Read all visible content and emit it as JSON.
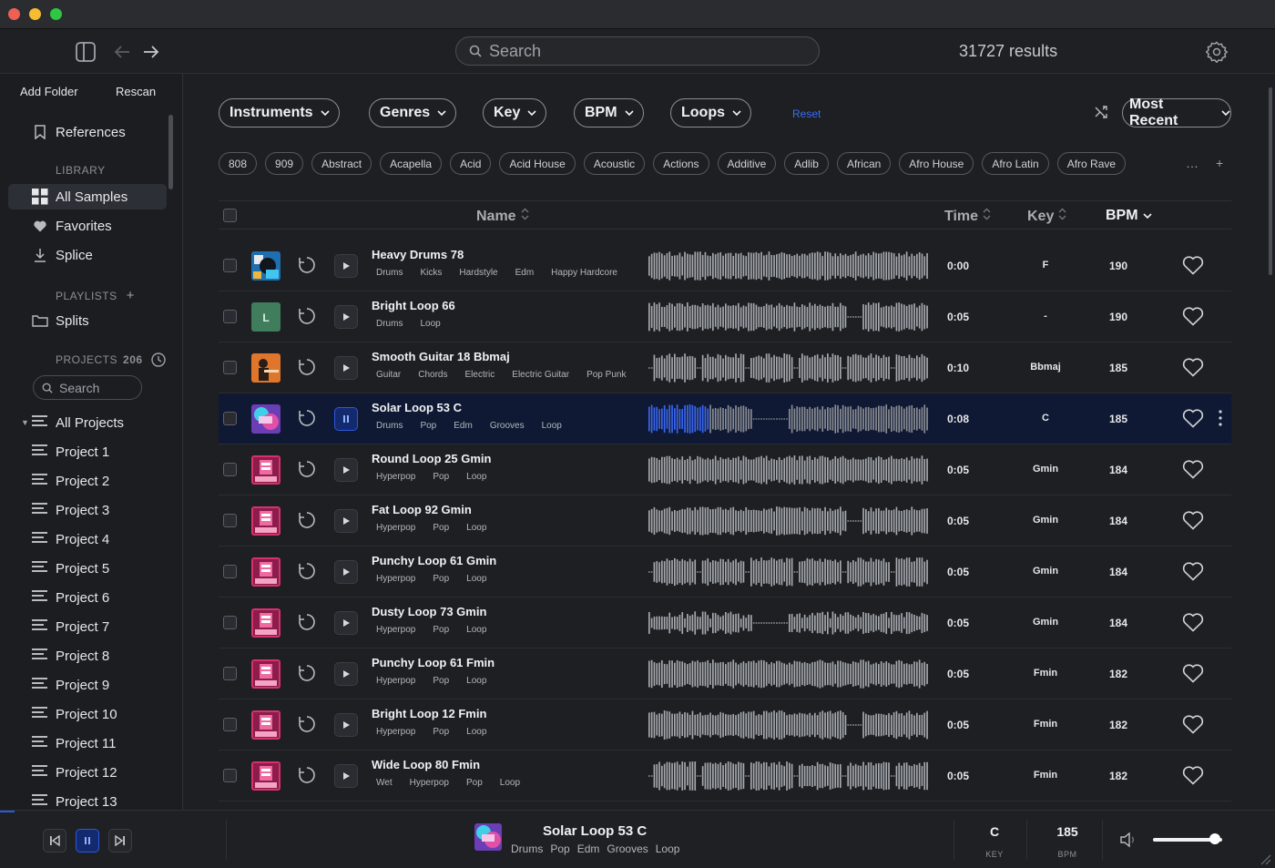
{
  "toolbar": {
    "search_placeholder": "Search",
    "results_count": "31727 results"
  },
  "sidebar": {
    "add_folder": "Add Folder",
    "rescan": "Rescan",
    "references": "References",
    "library_heading": "LIBRARY",
    "all_samples": "All Samples",
    "favorites": "Favorites",
    "splice": "Splice",
    "playlists_heading": "PLAYLISTS",
    "splits": "Splits",
    "projects_heading": "PROJECTS",
    "projects_count": "206",
    "search_placeholder": "Search",
    "all_projects": "All Projects",
    "projects": [
      "Project 1",
      "Project 2",
      "Project 3",
      "Project 4",
      "Project 5",
      "Project 6",
      "Project 7",
      "Project 8",
      "Project 9",
      "Project 10",
      "Project 11",
      "Project 12",
      "Project 13"
    ]
  },
  "filters": {
    "instruments": "Instruments",
    "genres": "Genres",
    "key": "Key",
    "bpm": "BPM",
    "loops": "Loops",
    "reset": "Reset",
    "sort": "Most Recent"
  },
  "tags": [
    "808",
    "909",
    "Abstract",
    "Acapella",
    "Acid",
    "Acid House",
    "Acoustic",
    "Actions",
    "Additive",
    "Adlib",
    "African",
    "Afro House",
    "Afro Latin",
    "Afro Rave"
  ],
  "table": {
    "col_name": "Name",
    "col_time": "Time",
    "col_key": "Key",
    "col_bpm": "BPM",
    "rows": [
      {
        "name": "Heavy Drums 78",
        "tags": [
          "Drums",
          "Kicks",
          "Hardstyle",
          "Edm",
          "Happy Hardcore"
        ],
        "time": "0:00",
        "key": "F",
        "bpm": "190",
        "thumb": "art-blue"
      },
      {
        "name": "Bright Loop 66",
        "tags": [
          "Drums",
          "Loop"
        ],
        "time": "0:05",
        "key": "-",
        "bpm": "190",
        "thumb": "letter-L"
      },
      {
        "name": "Smooth Guitar 18 Bbmaj",
        "tags": [
          "Guitar",
          "Chords",
          "Electric",
          "Electric Guitar",
          "Pop Punk"
        ],
        "time": "0:10",
        "key": "Bbmaj",
        "bpm": "185",
        "thumb": "art-orange"
      },
      {
        "name": "Solar Loop 53 C",
        "tags": [
          "Drums",
          "Pop",
          "Edm",
          "Grooves",
          "Loop"
        ],
        "time": "0:08",
        "key": "C",
        "bpm": "185",
        "thumb": "art-purple",
        "active": true
      },
      {
        "name": "Round Loop 25 Gmin",
        "tags": [
          "Hyperpop",
          "Pop",
          "Loop"
        ],
        "time": "0:05",
        "key": "Gmin",
        "bpm": "184",
        "thumb": "art-pink"
      },
      {
        "name": "Fat Loop 92 Gmin",
        "tags": [
          "Hyperpop",
          "Pop",
          "Loop"
        ],
        "time": "0:05",
        "key": "Gmin",
        "bpm": "184",
        "thumb": "art-pink"
      },
      {
        "name": "Punchy Loop 61 Gmin",
        "tags": [
          "Hyperpop",
          "Pop",
          "Loop"
        ],
        "time": "0:05",
        "key": "Gmin",
        "bpm": "184",
        "thumb": "art-pink"
      },
      {
        "name": "Dusty Loop 73 Gmin",
        "tags": [
          "Hyperpop",
          "Pop",
          "Loop"
        ],
        "time": "0:05",
        "key": "Gmin",
        "bpm": "184",
        "thumb": "art-pink"
      },
      {
        "name": "Punchy Loop 61 Fmin",
        "tags": [
          "Hyperpop",
          "Pop",
          "Loop"
        ],
        "time": "0:05",
        "key": "Fmin",
        "bpm": "182",
        "thumb": "art-pink"
      },
      {
        "name": "Bright Loop 12 Fmin",
        "tags": [
          "Hyperpop",
          "Pop",
          "Loop"
        ],
        "time": "0:05",
        "key": "Fmin",
        "bpm": "182",
        "thumb": "art-pink"
      },
      {
        "name": "Wide Loop 80 Fmin",
        "tags": [
          "Wet",
          "Hyperpop",
          "Pop",
          "Loop"
        ],
        "time": "0:05",
        "key": "Fmin",
        "bpm": "182",
        "thumb": "art-pink"
      }
    ]
  },
  "player": {
    "title": "Solar Loop 53 C",
    "tags": [
      "Drums",
      "Pop",
      "Edm",
      "Grooves",
      "Loop"
    ],
    "key": "C",
    "key_caption": "KEY",
    "bpm": "185",
    "bpm_caption": "BPM",
    "volume": 0.9
  },
  "colors": {
    "accent": "#2b59e0",
    "active_row": "#0f1933",
    "background": "#1d1f23"
  }
}
